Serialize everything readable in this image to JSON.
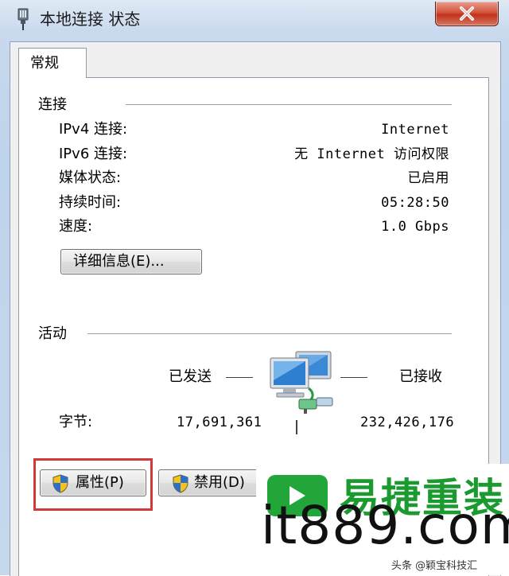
{
  "window": {
    "title": "本地连接 状态",
    "icon": "network-adapter-icon",
    "close_icon": "close-icon"
  },
  "tabs": [
    {
      "label": "常规",
      "selected": true
    }
  ],
  "connection": {
    "group_title": "连接",
    "rows": [
      {
        "label": "IPv4 连接:",
        "value": "Internet"
      },
      {
        "label": "IPv6 连接:",
        "value": "无 Internet 访问权限"
      },
      {
        "label": "媒体状态:",
        "value": "已启用"
      },
      {
        "label": "持续时间:",
        "value": "05:28:50"
      },
      {
        "label": "速度:",
        "value": "1.0 Gbps"
      }
    ],
    "details_button": "详细信息(E)..."
  },
  "activity": {
    "group_title": "活动",
    "sent_label": "已发送",
    "received_label": "已接收",
    "bytes_label": "字节:",
    "bytes_sent": "17,691,361",
    "bytes_received": "232,426,176",
    "icon": "network-computers-icon"
  },
  "buttons": {
    "properties": "属性(P)",
    "disable": "禁用(D)"
  },
  "colors": {
    "highlight_border": "#d23a3a",
    "close_button": "#c0321c",
    "watermark_green": "#1b9a30"
  },
  "watermark": {
    "brand": "易捷重装",
    "site": "it889.com",
    "caption": "头条 @颖宝科技汇"
  }
}
